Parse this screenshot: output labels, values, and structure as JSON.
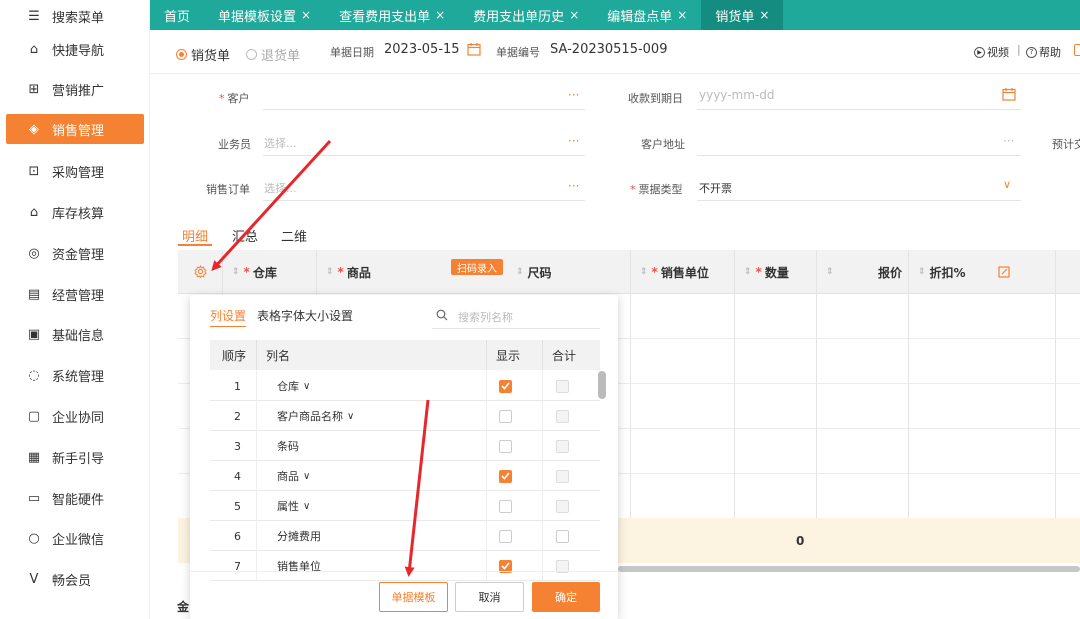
{
  "sidebar": {
    "items": [
      {
        "label": "搜索菜单",
        "icon": "search-menu-icon"
      },
      {
        "label": "快捷导航",
        "icon": "home-icon"
      },
      {
        "label": "营销推广",
        "icon": "gift-icon"
      },
      {
        "label": "销售管理",
        "icon": "sales-icon",
        "active": true
      },
      {
        "label": "采购管理",
        "icon": "purchase-icon"
      },
      {
        "label": "库存核算",
        "icon": "warehouse-icon"
      },
      {
        "label": "资金管理",
        "icon": "money-icon"
      },
      {
        "label": "经营管理",
        "icon": "clipboard-icon"
      },
      {
        "label": "基础信息",
        "icon": "info-card-icon"
      },
      {
        "label": "系统管理",
        "icon": "system-icon"
      },
      {
        "label": "企业协同",
        "icon": "collab-icon"
      },
      {
        "label": "新手引导",
        "icon": "guide-icon"
      },
      {
        "label": "智能硬件",
        "icon": "hardware-icon"
      },
      {
        "label": "企业微信",
        "icon": "wechat-icon"
      },
      {
        "label": "畅会员",
        "icon": "vip-icon"
      }
    ]
  },
  "top_tabs": [
    {
      "label": "首页",
      "closable": false
    },
    {
      "label": "单据模板设置",
      "closable": true
    },
    {
      "label": "查看费用支出单",
      "closable": true
    },
    {
      "label": "费用支出单历史",
      "closable": true
    },
    {
      "label": "编辑盘点单",
      "closable": true
    },
    {
      "label": "销货单",
      "closable": true,
      "active": true
    }
  ],
  "close_glyph": "×",
  "header": {
    "radio_sales": "销货单",
    "radio_return": "退货单",
    "date_label": "单据日期",
    "date_value": "2023-05-15",
    "no_label": "单据编号",
    "no_value": "SA-20230515-009",
    "video": "视频",
    "separator": "|",
    "help": "帮助"
  },
  "form": {
    "required_mark": "*",
    "customer_label": "客户",
    "due_date_label": "收款到期日",
    "due_date_placeholder": "yyyy-mm-dd",
    "salesman_label": "业务员",
    "salesman_placeholder": "选择...",
    "address_label": "客户地址",
    "expected_label": "预计交",
    "order_label": "销售订单",
    "order_placeholder": "选择...",
    "ticket_label": "票据类型",
    "ticket_value": "不开票",
    "more_glyph": "···",
    "chevron_glyph": "∨"
  },
  "subtabs": [
    "明细",
    "汇总",
    "二维"
  ],
  "grid": {
    "columns": [
      {
        "label": "仓库",
        "required": true
      },
      {
        "label": "商品",
        "required": true
      },
      {
        "label": "尺码",
        "required": false
      },
      {
        "label": "销售单位",
        "required": true
      },
      {
        "label": "数量",
        "required": true
      },
      {
        "label": "报价",
        "required": false
      },
      {
        "label": "折扣%",
        "required": false
      }
    ],
    "scan_button": "扫码录入",
    "total_qty": "0",
    "amount_label_partial": "金"
  },
  "popup": {
    "tab_columns": "列设置",
    "tab_font": "表格字体大小设置",
    "search_placeholder": "搜索列名称",
    "headers": {
      "order": "顺序",
      "name": "列名",
      "show": "显示",
      "sum": "合计"
    },
    "rows": [
      {
        "order": "1",
        "name": "仓库",
        "chevron": true,
        "show": true,
        "sum_enabled": false
      },
      {
        "order": "2",
        "name": "客户商品名称",
        "chevron": true,
        "show": false,
        "sum_enabled": false
      },
      {
        "order": "3",
        "name": "条码",
        "chevron": false,
        "show": false,
        "sum_enabled": false
      },
      {
        "order": "4",
        "name": "商品",
        "chevron": true,
        "show": true,
        "sum_enabled": false
      },
      {
        "order": "5",
        "name": "属性",
        "chevron": true,
        "show": false,
        "sum_enabled": false
      },
      {
        "order": "6",
        "name": "分摊费用",
        "chevron": false,
        "show": false,
        "sum_enabled": true
      },
      {
        "order": "7",
        "name": "销售单位",
        "chevron": false,
        "show": true,
        "sum_enabled": false
      }
    ],
    "btn_template": "单据模板",
    "btn_cancel": "取消",
    "btn_confirm": "确定"
  },
  "colors": {
    "accent": "#f58232",
    "topbar": "#1fa99a",
    "annotation_arrow": "#e8262b"
  }
}
